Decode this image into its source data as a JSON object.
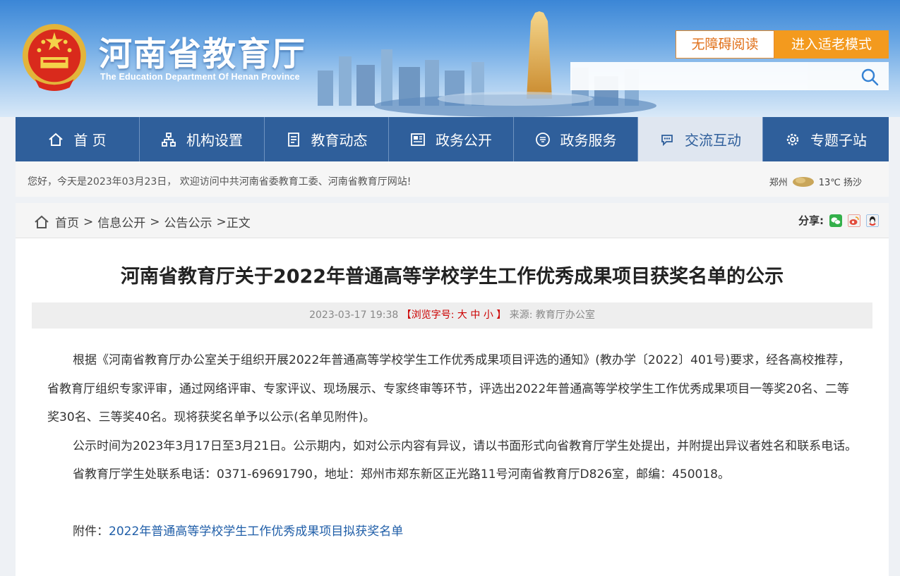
{
  "header": {
    "site_title": "河南省教育厅",
    "site_subtitle": "The Education Department Of Henan Province",
    "accessible_label": "无障碍阅读",
    "elder_mode_label": "进入适老模式",
    "search_placeholder": ""
  },
  "nav": {
    "items": [
      {
        "label": "首 页",
        "icon": "home-icon"
      },
      {
        "label": "机构设置",
        "icon": "org-chart-icon"
      },
      {
        "label": "教育动态",
        "icon": "document-icon"
      },
      {
        "label": "政务公开",
        "icon": "newspaper-icon"
      },
      {
        "label": "政务服务",
        "icon": "service-badge-icon"
      },
      {
        "label": "交流互动",
        "icon": "chat-icon",
        "active": true
      },
      {
        "label": "专题子站",
        "icon": "gear-icon"
      }
    ]
  },
  "greeting": {
    "text": "您好，今天是2023年03月23日， 欢迎访问中共河南省委教育工委、河南省教育厅网站!",
    "city": "郑州",
    "temp": "13℃ 扬沙",
    "weather_icon": "dust-icon"
  },
  "breadcrumb": {
    "items": [
      "首页",
      "信息公开",
      "公告公示"
    ],
    "current": "正文",
    "sep": ">"
  },
  "share": {
    "label": "分享:",
    "icons": [
      "wechat-icon",
      "weibo-icon",
      "qq-icon"
    ]
  },
  "article": {
    "title": "河南省教育厅关于2022年普通高等学校学生工作优秀成果项目获奖名单的公示",
    "date": "2023-03-17 19:38",
    "font_label_open": "【浏览字号:",
    "font_large": "大",
    "font_medium": "中",
    "font_small": "小",
    "font_label_close": "】",
    "source": "来源: 教育厅办公室",
    "paragraphs": [
      "根据《河南省教育厅办公室关于组织开展2022年普通高等学校学生工作优秀成果项目评选的通知》(教办学〔2022〕401号)要求，经各高校推荐，省教育厅组织专家评审，通过网络评审、专家评议、现场展示、专家终审等环节，评选出2022年普通高等学校学生工作优秀成果项目一等奖20名、二等奖30名、三等奖40名。现将获奖名单予以公示(名单见附件)。",
      "公示时间为2023年3月17日至3月21日。公示期内，如对公示内容有异议，请以书面形式向省教育厅学生处提出，并附提出异议者姓名和联系电话。",
      "省教育厅学生处联系电话：0371-69691790，地址：郑州市郑东新区正光路11号河南省教育厅D826室，邮编：450018。"
    ],
    "attachment_label": "附件：",
    "attachment_link": "2022年普通高等学校学生工作优秀成果项目拟获奖名单"
  },
  "colors": {
    "nav_bg": "#2f5f9b",
    "nav_active_bg": "#dfe6f0",
    "elder_btn": "#f39a1e",
    "link": "#1f5ea8",
    "meta_highlight": "#cc0000"
  }
}
